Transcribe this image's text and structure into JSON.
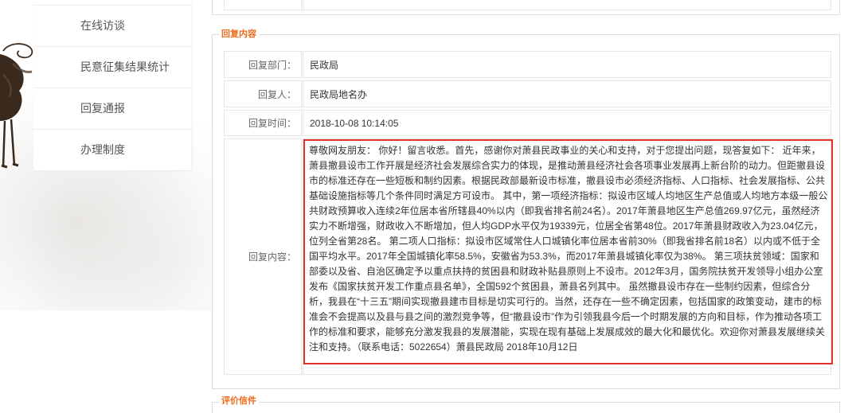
{
  "sidebar": {
    "items": [
      {
        "label": "在线访谈"
      },
      {
        "label": "民意征集结果统计"
      },
      {
        "label": "回复通报"
      },
      {
        "label": "办理制度"
      }
    ]
  },
  "reply": {
    "legend": "回复内容",
    "rows": [
      {
        "label": "回复部门：",
        "value": "民政局"
      },
      {
        "label": "回复人：",
        "value": "民政局地名办"
      },
      {
        "label": "回复时间：",
        "value": "2018-10-08 10:14:05"
      },
      {
        "label": "回复内容：",
        "value": "尊敬网友朋友： 你好！留言收悉。首先，感谢你对萧县民政事业的关心和支持，对于您提出问题，现答复如下： 近年来，萧县撤县设市工作开展是经济社会发展综合实力的体现，是推动萧县经济社会各项事业发展再上新台阶的动力。但距撤县设市的标准还存在一些短板和制约因素。根据民政部最新设市标准，撤县设市必须经济指标、人口指标、社会发展指标、公共基础设施指标等几个条件同时满足方可设市。 其中，第一项经济指标：拟设市区域人均地区生产总值或人均地方本级一般公共财政预算收入连续2年位居本省所辖县40%以内（即我省排名前24名）。2017年萧县地区生产总值269.97亿元，虽然经济实力不断增强，财政收入不断增加，但人均GDP水平仅为19339元，位居全省第48位。2017年萧县财政收入为23.04亿元，位列全省第28名。 第二项人口指标：拟设市区域常住人口城镇化率位居本省前30%（即我省排名前18名）以内或不低于全国平均水平。2017年全国城镇化率58.5%，安徽省为53.3%，而2017年萧县城镇化率仅为38%。 第三项扶贫领域：国家和部委以及省、自治区确定予以重点扶持的贫困县和财政补贴县原则上不设市。2012年3月，国务院扶贫开发领导小组办公室发布《国家扶贫开发工作重点县名单》，全国592个贫困县，萧县名列其中。 虽然撤县设市存在一些制约因素，但综合分析，我县在“十三五”期间实现撤县建市目标是切实可行的。当然，还存在一些不确定因素，包括国家的政策变动，建市的标准会不会提高以及县与县之间的激烈竞争等，但“撤县设市”作为引领我县今后一个时期发展的方向和目标，作为推动各项工作的标准和要求，能够充分激发我县的发展潜能，实现在现有基础上发展成效的最大化和最优化。欢迎你对萧县发展继续关注和支持。（联系电话：5022654）萧县民政局 2018年10月12日"
      }
    ]
  },
  "evaluation": {
    "legend": "评价信件"
  },
  "colors": {
    "legend": "#ee6a1b",
    "highlight_border": "#e2322b",
    "label_text": "#666666",
    "value_text": "#333333",
    "sidebar_text": "#555555"
  },
  "icons": {
    "decoration": "horse-ink-painting"
  }
}
